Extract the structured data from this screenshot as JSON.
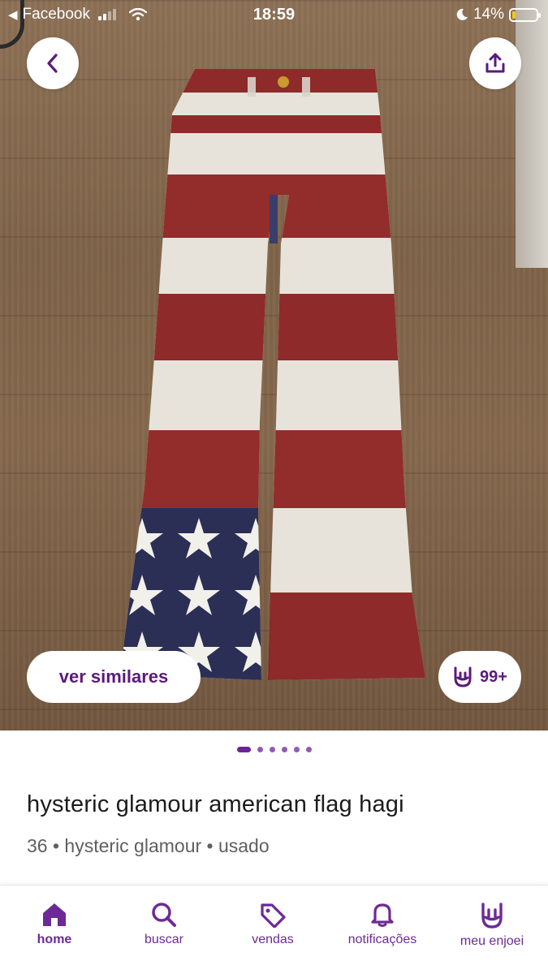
{
  "status_bar": {
    "back_app": "Facebook",
    "time": "18:59",
    "battery": "14%"
  },
  "actions": {
    "similar_label": "ver similares",
    "likes_count": "99+"
  },
  "gallery": {
    "total_images": 6,
    "current_index": 1
  },
  "product": {
    "title": "hysteric glamour american flag hagi",
    "meta": "36 • hysteric glamour • usado"
  },
  "nav": {
    "items": [
      {
        "label": "home",
        "icon": "home-icon",
        "active": true
      },
      {
        "label": "buscar",
        "icon": "search-icon"
      },
      {
        "label": "vendas",
        "icon": "tag-icon"
      },
      {
        "label": "notificações",
        "icon": "bell-icon"
      },
      {
        "label": "meu enjoei",
        "icon": "rock-hand-icon"
      }
    ]
  },
  "colors": {
    "brand_purple": "#6d2a96",
    "flag_red": "#8e2a2a",
    "flag_white": "#e7e3da",
    "flag_blue": "#2b2f55"
  }
}
